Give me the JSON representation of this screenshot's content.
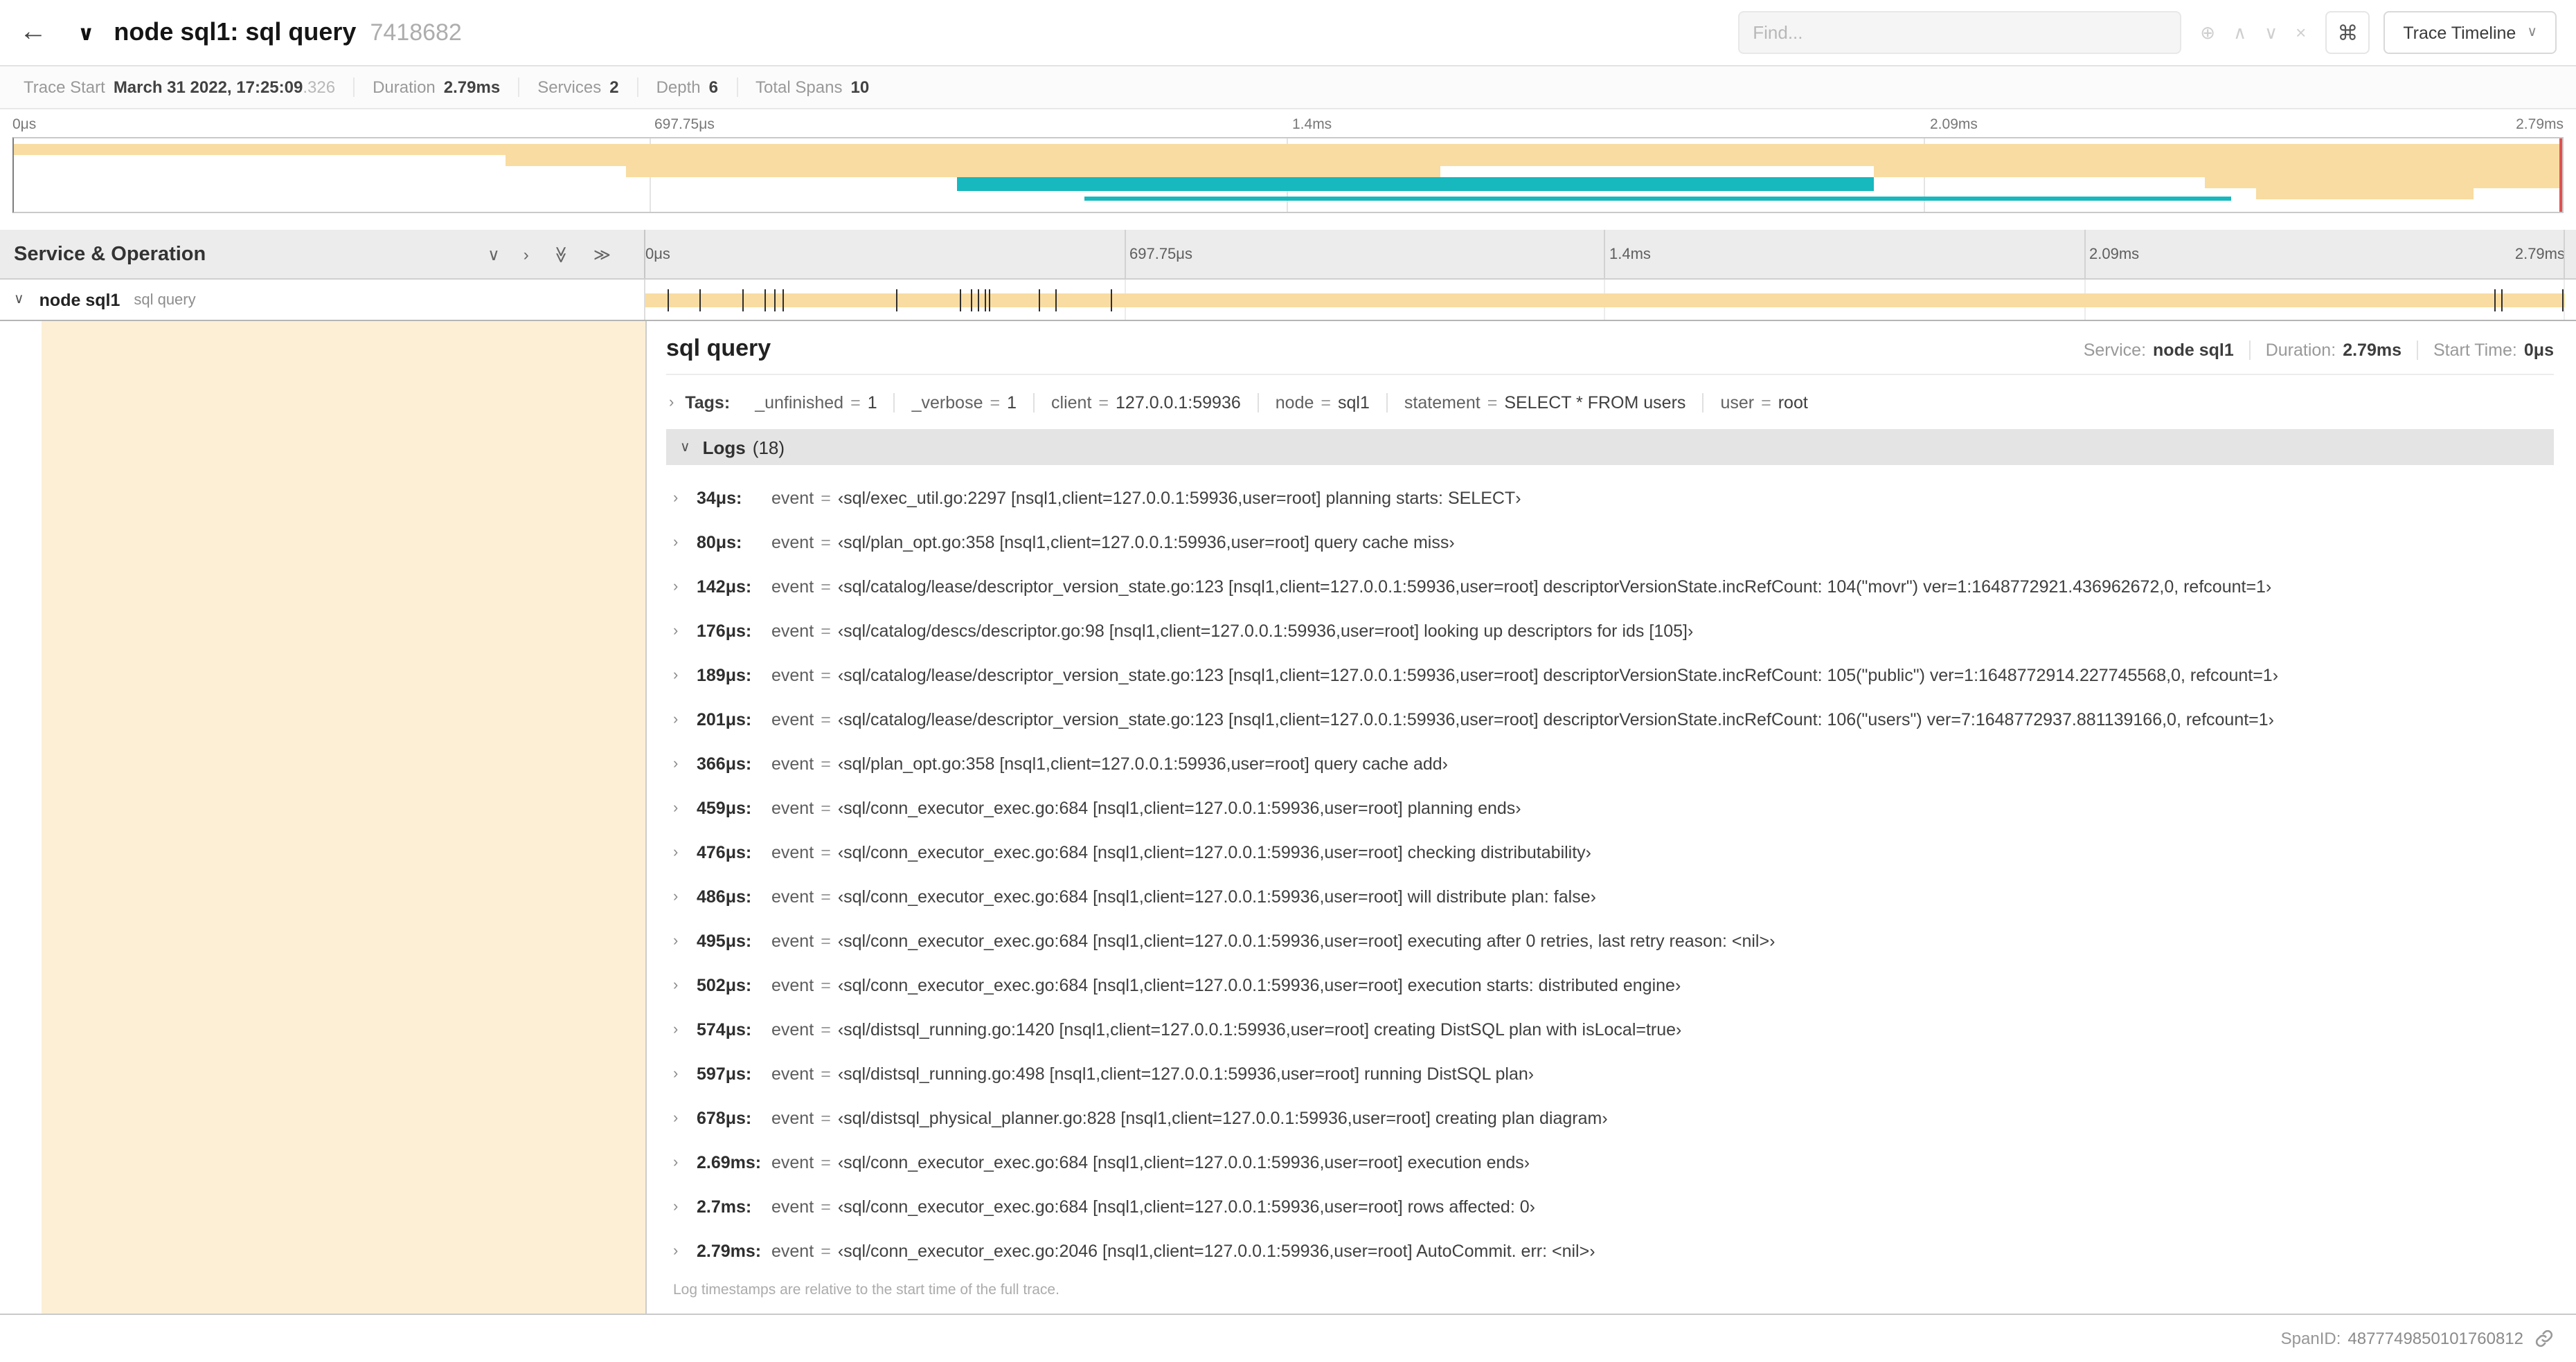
{
  "colors": {
    "span_tan": "#F8DCA1",
    "span_teal": "#17B8BE",
    "scrubber_red": "#E25050",
    "detail_accent": "rgba(248,220,161,0.45)"
  },
  "icons": {
    "back": "←",
    "collapse": "∨",
    "chevron_down": "∨",
    "chevron_right": "›",
    "dbl_chevron": "≫",
    "find_target": "⊕",
    "find_prev": "∧",
    "find_next": "∨",
    "find_clear": "×",
    "cmd": "⌘",
    "caret_down": "∨"
  },
  "header": {
    "title": "node sql1: sql query",
    "trace_id": "7418682",
    "find_placeholder": "Find...",
    "view_label": "Trace Timeline"
  },
  "summary": {
    "items": [
      {
        "label": "Trace Start",
        "value": "March 31 2022, 17:25:09",
        "suffix": ".326"
      },
      {
        "label": "Duration",
        "value": "2.79ms"
      },
      {
        "label": "Services",
        "value": "2"
      },
      {
        "label": "Depth",
        "value": "6"
      },
      {
        "label": "Total Spans",
        "value": "10"
      }
    ]
  },
  "timeline": {
    "left_title": "Service & Operation",
    "tick_labels": [
      "0μs",
      "697.75μs",
      "1.4ms",
      "2.09ms",
      "2.79ms"
    ]
  },
  "minimap": {
    "spans": [
      {
        "x1": 0.0,
        "x2": 1.0,
        "y": 4,
        "h": 8,
        "color": "span_tan"
      },
      {
        "x1": 0.193,
        "x2": 1.0,
        "y": 12,
        "h": 8,
        "color": "span_tan"
      },
      {
        "x1": 0.24,
        "x2": 0.56,
        "y": 20,
        "h": 8,
        "color": "span_tan"
      },
      {
        "x1": 0.73,
        "x2": 1.0,
        "y": 20,
        "h": 8,
        "color": "span_tan"
      },
      {
        "x1": 0.37,
        "x2": 0.73,
        "y": 28,
        "h": 10,
        "color": "span_teal"
      },
      {
        "x1": 0.86,
        "x2": 1.0,
        "y": 28,
        "h": 8,
        "color": "span_tan"
      },
      {
        "x1": 0.88,
        "x2": 0.965,
        "y": 36,
        "h": 8,
        "color": "span_tan"
      },
      {
        "x1": 0.42,
        "x2": 0.87,
        "y": 42,
        "h": 3,
        "color": "span_teal"
      }
    ]
  },
  "span_row": {
    "service": "node sql1",
    "operation": "sql query",
    "event_ticks": [
      0.0122,
      0.0287,
      0.0509,
      0.0631,
      0.0677,
      0.072,
      0.1312,
      0.1645,
      0.1706,
      0.1742,
      0.1774,
      0.1799,
      0.2057,
      0.214,
      0.243,
      0.9642,
      0.9677,
      0.999
    ]
  },
  "detail": {
    "title": "sql query",
    "meta": [
      {
        "label": "Service:",
        "value": "node sql1"
      },
      {
        "label": "Duration:",
        "value": "2.79ms"
      },
      {
        "label": "Start Time:",
        "value": "0μs"
      }
    ],
    "tags_label": "Tags:",
    "tags": [
      {
        "key": "_unfinished",
        "value": "1"
      },
      {
        "key": "_verbose",
        "value": "1"
      },
      {
        "key": "client",
        "value": "127.0.0.1:59936"
      },
      {
        "key": "node",
        "value": "sql1"
      },
      {
        "key": "statement",
        "value": "SELECT * FROM users"
      },
      {
        "key": "user",
        "value": "root"
      }
    ],
    "logs_label": "Logs",
    "logs_count": "(18)",
    "logs": [
      {
        "time": "34μs:",
        "key": "event",
        "value": "‹sql/exec_util.go:2297 [nsql1,client=127.0.0.1:59936,user=root] planning starts: SELECT›"
      },
      {
        "time": "80μs:",
        "key": "event",
        "value": "‹sql/plan_opt.go:358 [nsql1,client=127.0.0.1:59936,user=root] query cache miss›"
      },
      {
        "time": "142μs:",
        "key": "event",
        "value": "‹sql/catalog/lease/descriptor_version_state.go:123 [nsql1,client=127.0.0.1:59936,user=root] descriptorVersionState.incRefCount: 104(\"movr\") ver=1:1648772921.436962672,0, refcount=1›"
      },
      {
        "time": "176μs:",
        "key": "event",
        "value": "‹sql/catalog/descs/descriptor.go:98 [nsql1,client=127.0.0.1:59936,user=root] looking up descriptors for ids [105]›"
      },
      {
        "time": "189μs:",
        "key": "event",
        "value": "‹sql/catalog/lease/descriptor_version_state.go:123 [nsql1,client=127.0.0.1:59936,user=root] descriptorVersionState.incRefCount: 105(\"public\") ver=1:1648772914.227745568,0, refcount=1›"
      },
      {
        "time": "201μs:",
        "key": "event",
        "value": "‹sql/catalog/lease/descriptor_version_state.go:123 [nsql1,client=127.0.0.1:59936,user=root] descriptorVersionState.incRefCount: 106(\"users\") ver=7:1648772937.881139166,0, refcount=1›"
      },
      {
        "time": "366μs:",
        "key": "event",
        "value": "‹sql/plan_opt.go:358 [nsql1,client=127.0.0.1:59936,user=root] query cache add›"
      },
      {
        "time": "459μs:",
        "key": "event",
        "value": "‹sql/conn_executor_exec.go:684 [nsql1,client=127.0.0.1:59936,user=root] planning ends›"
      },
      {
        "time": "476μs:",
        "key": "event",
        "value": "‹sql/conn_executor_exec.go:684 [nsql1,client=127.0.0.1:59936,user=root] checking distributability›"
      },
      {
        "time": "486μs:",
        "key": "event",
        "value": "‹sql/conn_executor_exec.go:684 [nsql1,client=127.0.0.1:59936,user=root] will distribute plan: false›"
      },
      {
        "time": "495μs:",
        "key": "event",
        "value": "‹sql/conn_executor_exec.go:684 [nsql1,client=127.0.0.1:59936,user=root] executing after 0 retries, last retry reason: <nil>›"
      },
      {
        "time": "502μs:",
        "key": "event",
        "value": "‹sql/conn_executor_exec.go:684 [nsql1,client=127.0.0.1:59936,user=root] execution starts: distributed engine›"
      },
      {
        "time": "574μs:",
        "key": "event",
        "value": "‹sql/distsql_running.go:1420 [nsql1,client=127.0.0.1:59936,user=root] creating DistSQL plan with isLocal=true›"
      },
      {
        "time": "597μs:",
        "key": "event",
        "value": "‹sql/distsql_running.go:498 [nsql1,client=127.0.0.1:59936,user=root] running DistSQL plan›"
      },
      {
        "time": "678μs:",
        "key": "event",
        "value": "‹sql/distsql_physical_planner.go:828 [nsql1,client=127.0.0.1:59936,user=root] creating plan diagram›"
      },
      {
        "time": "2.69ms:",
        "key": "event",
        "value": "‹sql/conn_executor_exec.go:684 [nsql1,client=127.0.0.1:59936,user=root] execution ends›"
      },
      {
        "time": "2.7ms:",
        "key": "event",
        "value": "‹sql/conn_executor_exec.go:684 [nsql1,client=127.0.0.1:59936,user=root] rows affected: 0›"
      },
      {
        "time": "2.79ms:",
        "key": "event",
        "value": "‹sql/conn_executor_exec.go:2046 [nsql1,client=127.0.0.1:59936,user=root] AutoCommit. err: <nil>›"
      }
    ],
    "footer_note": "Log timestamps are relative to the start time of the full trace.",
    "span_id_label": "SpanID:",
    "span_id": "4877749850101760812"
  }
}
